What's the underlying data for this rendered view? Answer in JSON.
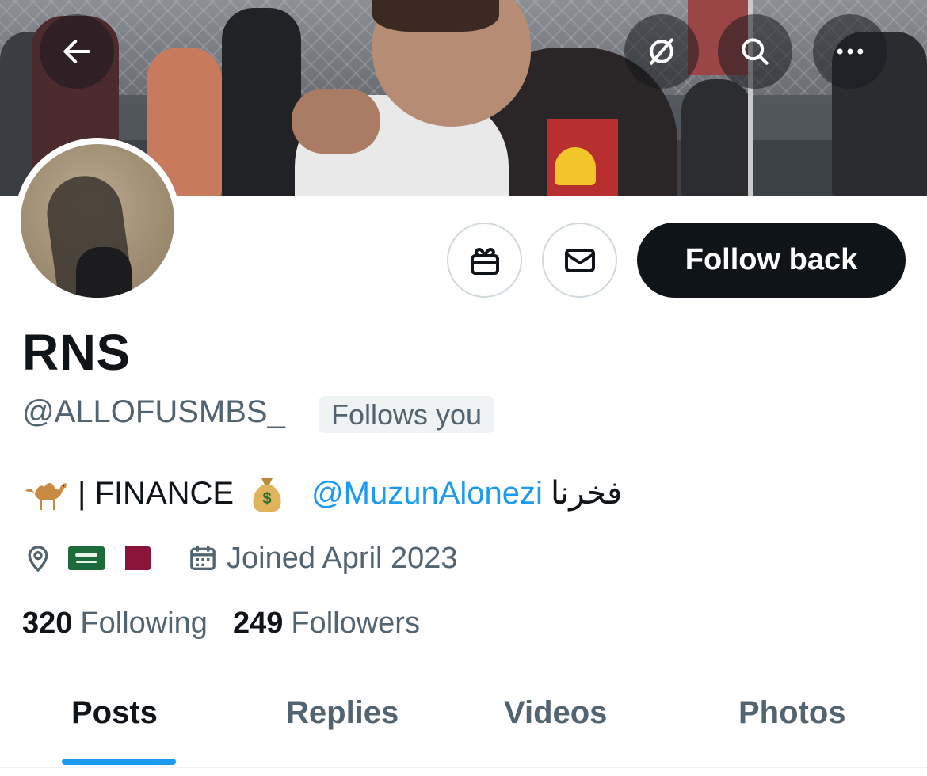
{
  "header": {
    "back_icon": "arrow-left-icon",
    "grok_icon": "grok-icon",
    "search_icon": "search-icon",
    "more_icon": "more-horizontal-icon"
  },
  "profile": {
    "name": "RNS",
    "handle": "@ALLOFUSMBS_",
    "follows_you": "Follows you",
    "bio": {
      "before": "| FINANCE",
      "mention": "@MuzunAlonezi",
      "arabic": "فخرنا"
    },
    "joined": "Joined April 2023",
    "following_count": "320",
    "following_label": "Following",
    "followers_count": "249",
    "followers_label": "Followers"
  },
  "actions": {
    "gift_icon": "gift-icon",
    "message_icon": "mail-icon",
    "follow_label": "Follow back"
  },
  "tabs": [
    {
      "label": "Posts",
      "active": true
    },
    {
      "label": "Replies",
      "active": false
    },
    {
      "label": "Videos",
      "active": false
    },
    {
      "label": "Photos",
      "active": false
    }
  ],
  "colors": {
    "accent": "#1d9bf0",
    "text_primary": "#0f1419",
    "text_secondary": "#536471",
    "button_dark": "#0f1419"
  }
}
